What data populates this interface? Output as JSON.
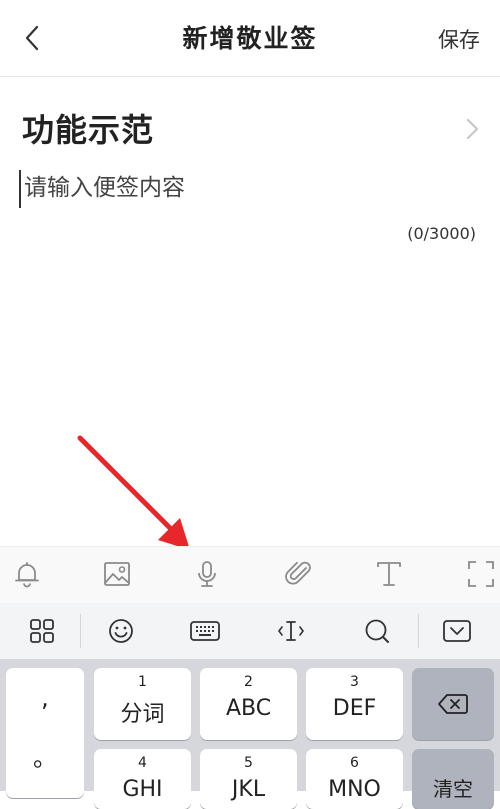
{
  "header": {
    "title": "新增敬业签",
    "save_label": "保存"
  },
  "note": {
    "category": "功能示范",
    "placeholder": "请输入便签内容",
    "value": "",
    "counter": "(0/3000)"
  },
  "toolbar": {
    "items": [
      "bell-icon",
      "image-icon",
      "microphone-icon",
      "paperclip-icon",
      "text-format-icon",
      "fullscreen-icon"
    ]
  },
  "ime_bar": {
    "items": [
      "grid-icon",
      "emoji-icon",
      "keyboard-icon",
      "cursor-move-icon",
      "search-icon",
      "keyboard-hide-icon"
    ]
  },
  "keyboard": {
    "punct": [
      ",",
      "。"
    ],
    "row1": [
      {
        "num": "1",
        "label": "分词"
      },
      {
        "num": "2",
        "label": "ABC"
      },
      {
        "num": "3",
        "label": "DEF"
      }
    ],
    "row2": [
      {
        "num": "4",
        "label": "GHI"
      },
      {
        "num": "5",
        "label": "JKL"
      },
      {
        "num": "6",
        "label": "MNO"
      }
    ],
    "clear_label": "清空"
  },
  "colors": {
    "annotation_arrow": "#e8272b",
    "key_dark": "#aeb3bd",
    "keyboard_bg": "#d5d7dc"
  }
}
